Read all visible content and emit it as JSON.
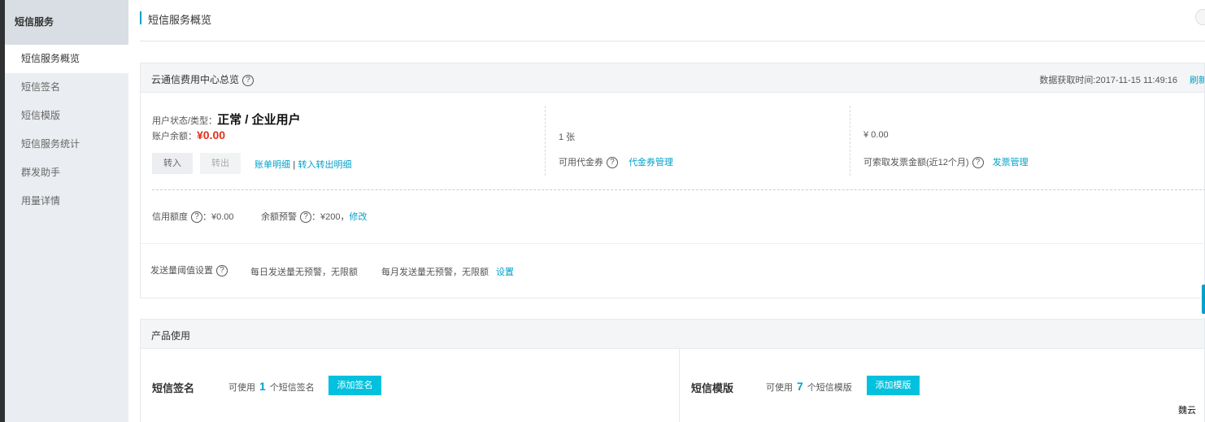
{
  "sidebar": {
    "title": "短信服务",
    "items": [
      {
        "label": "短信服务概览",
        "active": true
      },
      {
        "label": "短信签名",
        "active": false
      },
      {
        "label": "短信模版",
        "active": false
      },
      {
        "label": "短信服务统计",
        "active": false
      },
      {
        "label": "群发助手",
        "active": false
      },
      {
        "label": "用量详情",
        "active": false
      }
    ]
  },
  "page": {
    "title": "短信服务概览"
  },
  "overview": {
    "title": "云通信费用中心总览",
    "help_icon": "?",
    "fetch_time": "数据获取时间:2017-11-15 11:49:16",
    "refresh": "刷新",
    "user_status_label": "用户状态/类型：",
    "user_status_value": "正常 / 企业用户",
    "balance_label": "账户余额：",
    "balance_value": "¥0.00",
    "btn_in": "转入",
    "btn_out": "转出",
    "link_bill": "账单明细",
    "link_sep": "|",
    "link_transfer": "转入转出明细",
    "voucher_count": "1 张",
    "voucher_label": "可用代金券",
    "voucher_link": "代金券管理",
    "invoice_amount": "¥ 0.00",
    "invoice_label": "可索取发票金额(近12个月)",
    "invoice_link": "发票管理",
    "credit_label": "信用额度",
    "credit_value": "：¥0.00",
    "alert_label": "余额预警",
    "alert_value": "：¥200，",
    "alert_link": "修改",
    "threshold_label": "发送量阈值设置",
    "threshold_daily": "每日发送量无预警，无限额",
    "threshold_monthly": "每月发送量无预警，无限额",
    "threshold_link": "设置"
  },
  "product": {
    "title": "产品使用",
    "sign": {
      "title": "短信签名",
      "avail_prefix": "可使用",
      "count": "1",
      "avail_suffix": "个短信签名",
      "button": "添加签名"
    },
    "template": {
      "title": "短信模版",
      "avail_prefix": "可使用",
      "count": "7",
      "avail_suffix": "个短信模版",
      "button": "添加模版"
    }
  },
  "watermark": "魏云",
  "colors": {
    "accent": "#00a2ca",
    "button": "#00c1de",
    "balance": "#e0301e",
    "sidebar": "#eaedf1"
  }
}
